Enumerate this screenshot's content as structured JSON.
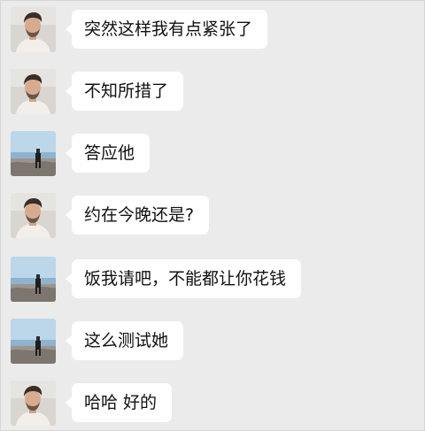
{
  "messages": [
    {
      "text": "突然这样我有点紧张了",
      "avatar": "man-avatar"
    },
    {
      "text": "不知所措了",
      "avatar": "man-avatar"
    },
    {
      "text": "答应他",
      "avatar": "seaside-avatar"
    },
    {
      "text": "约在今晚还是?",
      "avatar": "man-avatar"
    },
    {
      "text": "饭我请吧，不能都让你花钱",
      "avatar": "seaside-avatar"
    },
    {
      "text": "这么测试她",
      "avatar": "seaside-avatar"
    },
    {
      "text": "哈哈 好的",
      "avatar": "man-avatar"
    }
  ],
  "colors": {
    "background": "#ebebeb",
    "bubble": "#ffffff",
    "text": "#111111"
  }
}
